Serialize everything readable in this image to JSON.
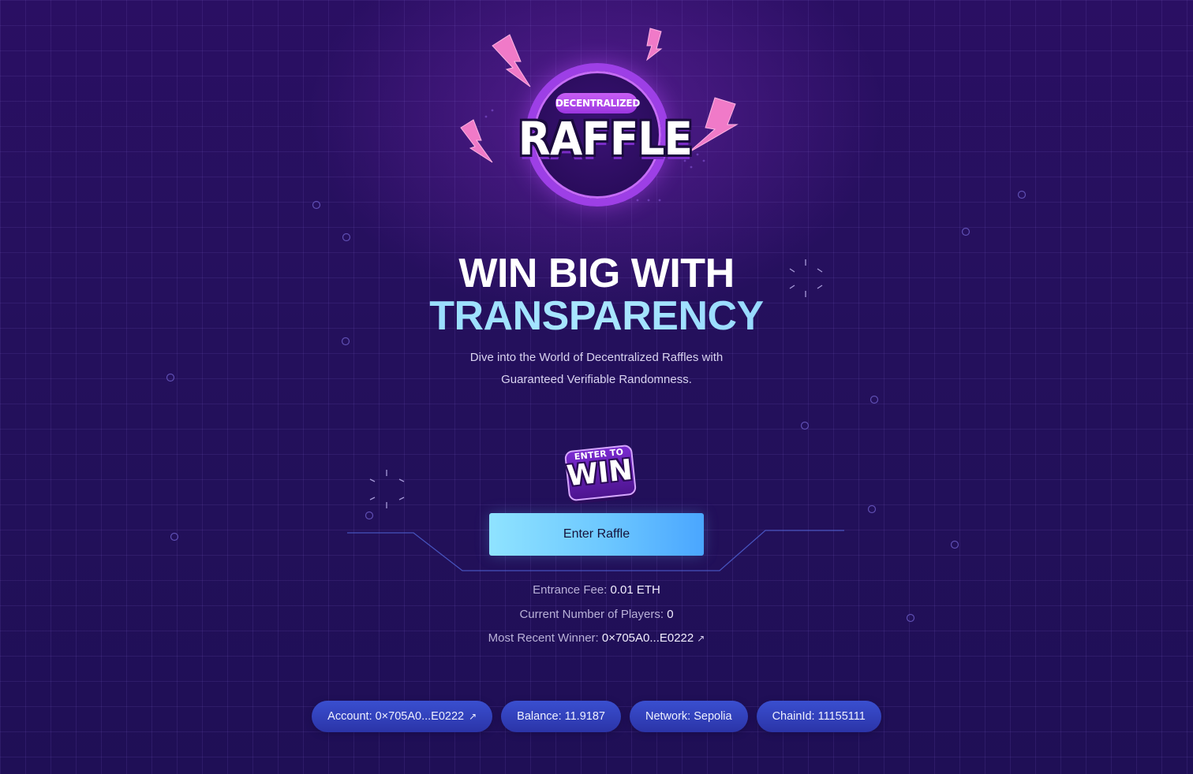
{
  "logo": {
    "tagline": "DECENTRALIZED",
    "wordmark": "RAFFLE"
  },
  "hero": {
    "headline_line1": "WIN BIG WITH",
    "headline_line2": "TRANSPARENCY",
    "subtitle": "Dive into the World of Decentralized Raffles with Guaranteed Verifiable Randomness."
  },
  "badge": {
    "top": "ENTER TO",
    "main": "WIN"
  },
  "enter_button": {
    "label": "Enter Raffle"
  },
  "info": {
    "fee_label": "Entrance Fee:",
    "fee_value": "0.01 ETH",
    "players_label": "Current Number of Players:",
    "players_value": "0",
    "winner_label": "Most Recent Winner:",
    "winner_value": "0×705A0...E0222"
  },
  "chips": {
    "account": "Account: 0×705A0...E0222",
    "balance": "Balance: 11.9187",
    "network": "Network: Sepolia",
    "chain": "ChainId: 11155111"
  },
  "icons": {
    "external": "external-link-arrow",
    "bolt": "lightning-bolt"
  },
  "colors": {
    "background": "#24105c",
    "accent_cyan": "#7fd0ff",
    "accent_purple": "#9d3fe6",
    "chip_blue": "#3446c0"
  }
}
